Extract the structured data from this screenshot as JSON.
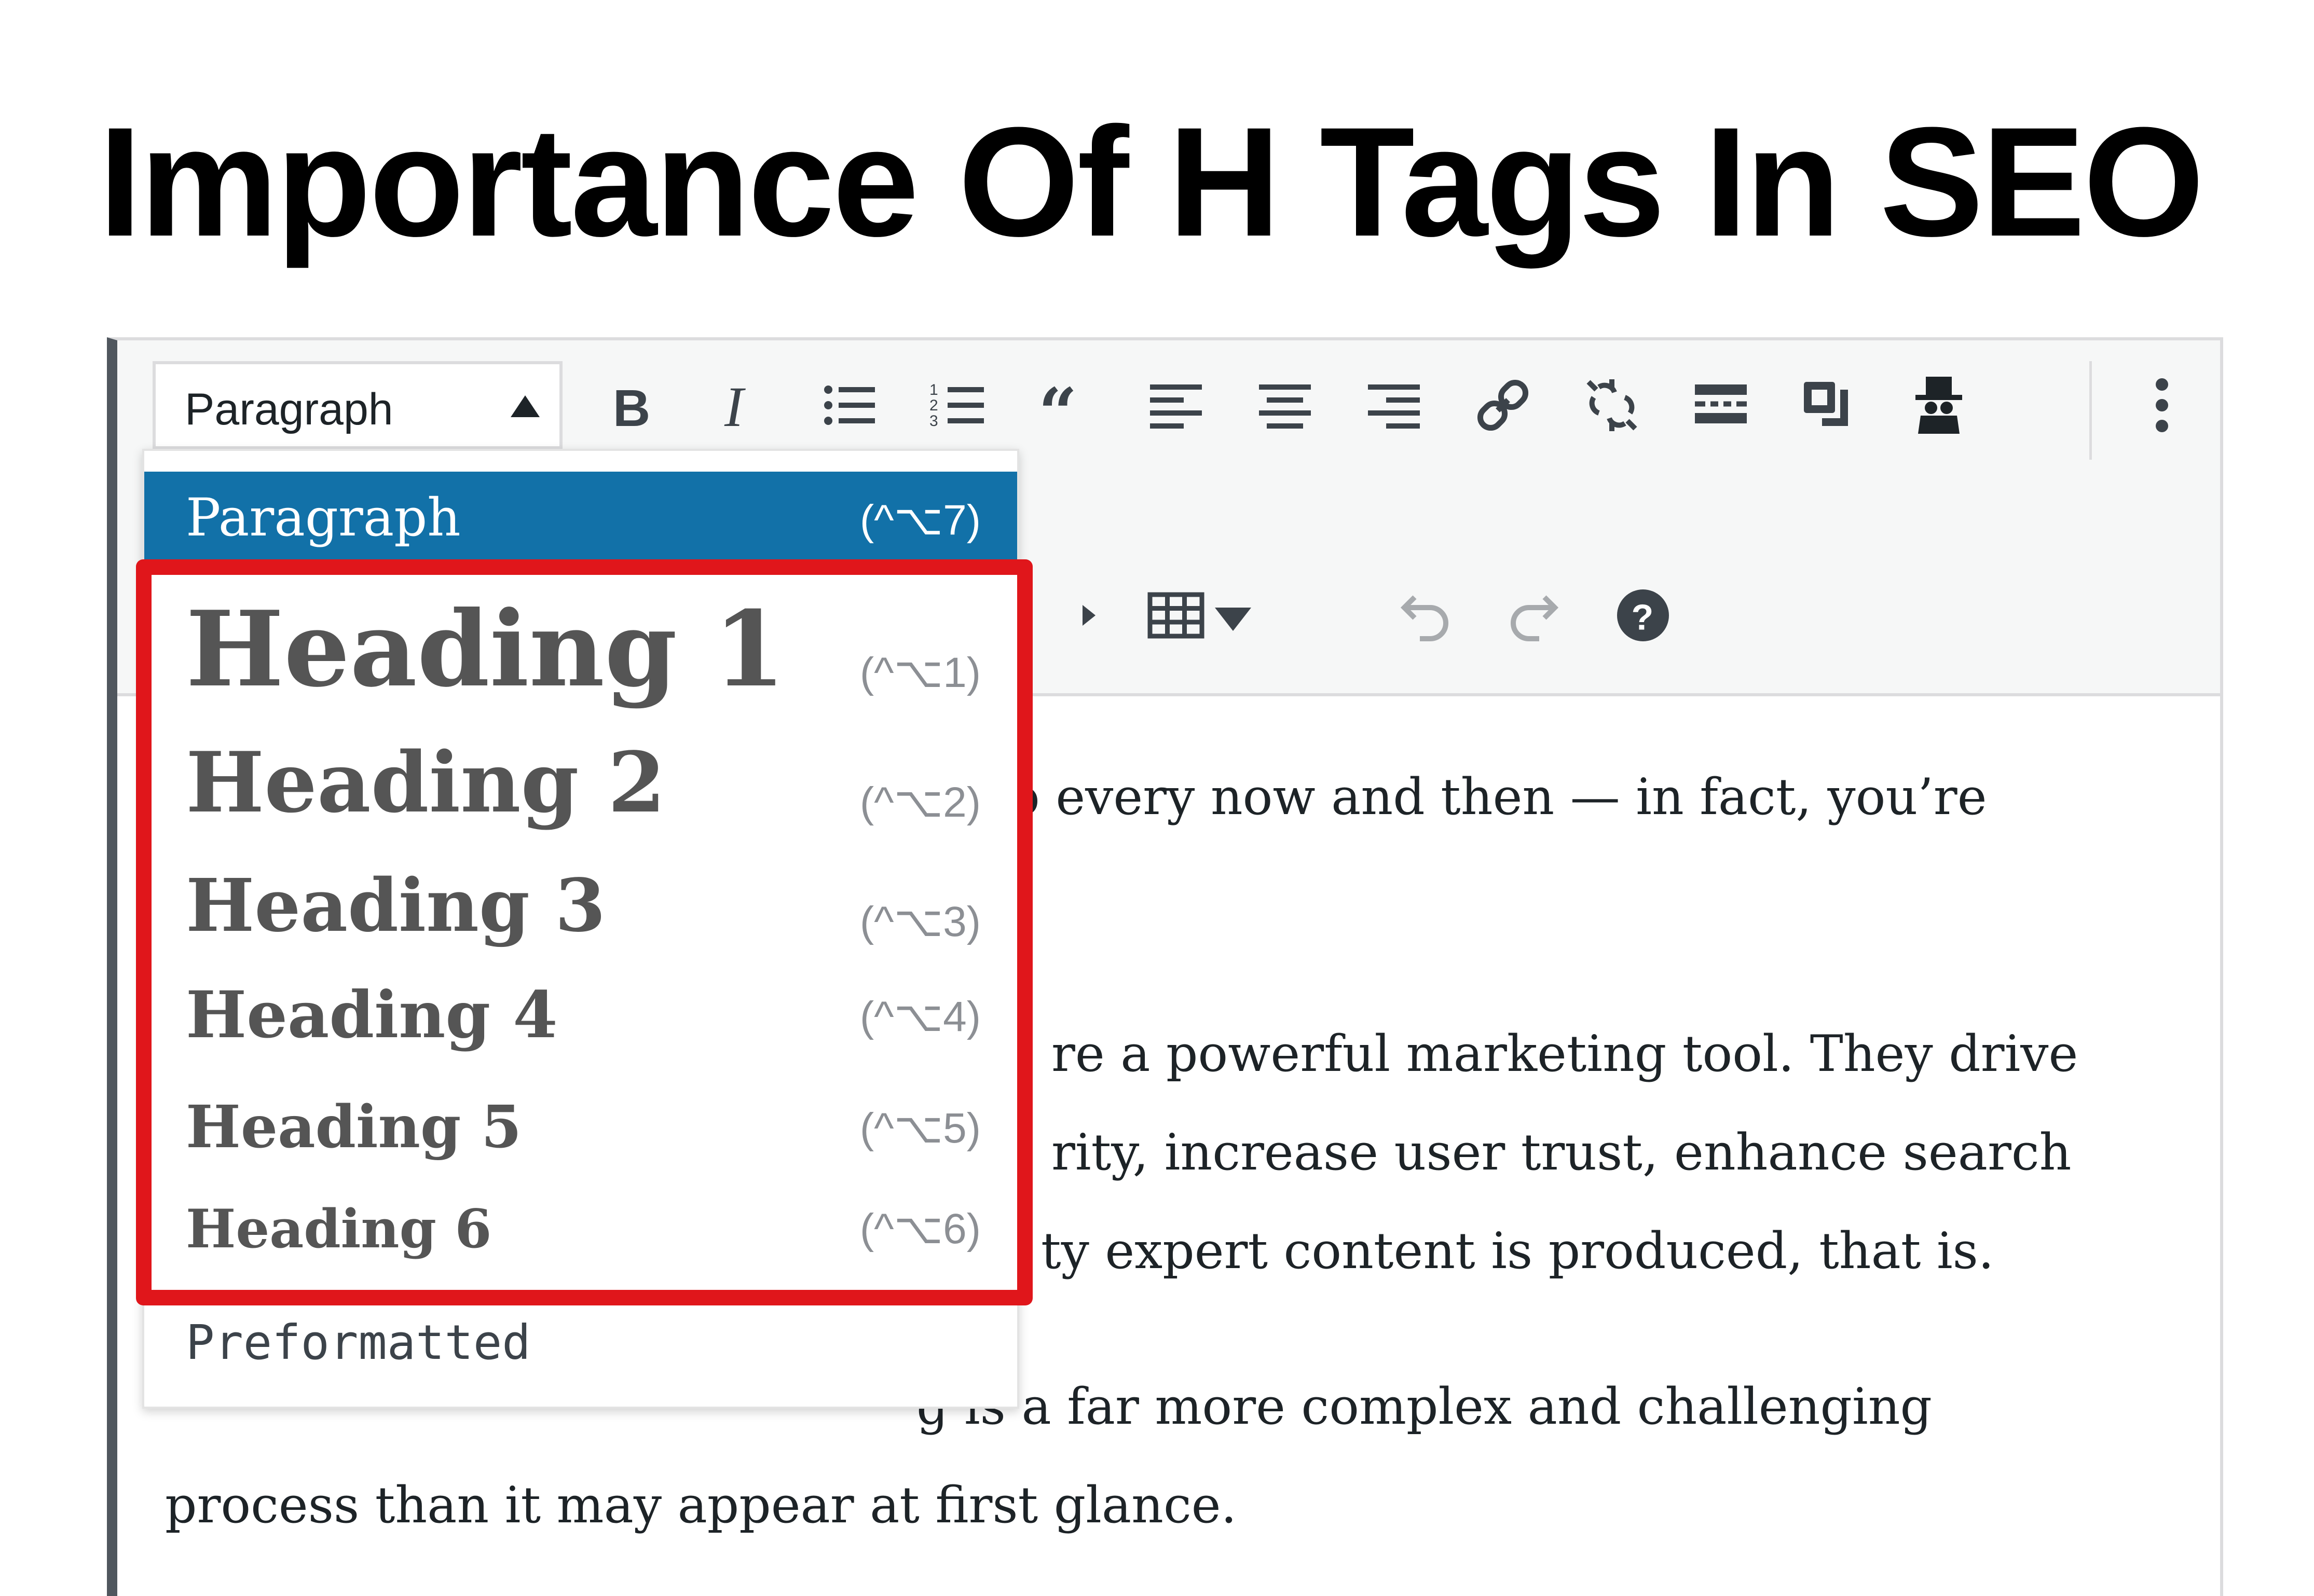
{
  "title": "Importance Of H Tags In SEO",
  "format_select": {
    "current": "Paragraph"
  },
  "toolbar_row1": [
    "bold-icon",
    "italic-icon",
    "bullet-list-icon",
    "numbered-list-icon",
    "blockquote-icon",
    "align-left-icon",
    "align-center-icon",
    "align-right-icon",
    "link-icon",
    "unlink-icon",
    "read-more-icon",
    "toolbar-toggle-icon",
    "incognito-icon",
    "more-options-icon"
  ],
  "toolbar_row2": [
    "indent-icon",
    "table-icon",
    "undo-icon",
    "redo-icon",
    "help-icon"
  ],
  "dropdown": {
    "items": [
      {
        "label": "Paragraph",
        "shortcut": "(^⌥7)"
      },
      {
        "label": "Heading 1",
        "shortcut": "(^⌥1)"
      },
      {
        "label": "Heading 2",
        "shortcut": "(^⌥2)"
      },
      {
        "label": "Heading 3",
        "shortcut": "(^⌥3)"
      },
      {
        "label": "Heading 4",
        "shortcut": "(^⌥4)"
      },
      {
        "label": "Heading 5",
        "shortcut": "(^⌥5)"
      },
      {
        "label": "Heading 6",
        "shortcut": "(^⌥6)"
      },
      {
        "label": "Preformatted",
        "shortcut": ""
      }
    ]
  },
  "content": {
    "line1": "o every now and then — in fact, you’re",
    "line2": "re a powerful marketing tool. They drive",
    "line3": "rity, increase user trust, enhance search",
    "line4": "ty expert content is produced, that is.",
    "line5": "g is a far more complex and challenging",
    "line6": "process than it may appear at first glance."
  },
  "colors": {
    "selected": "#1271a8",
    "highlight": "#e0161b"
  }
}
